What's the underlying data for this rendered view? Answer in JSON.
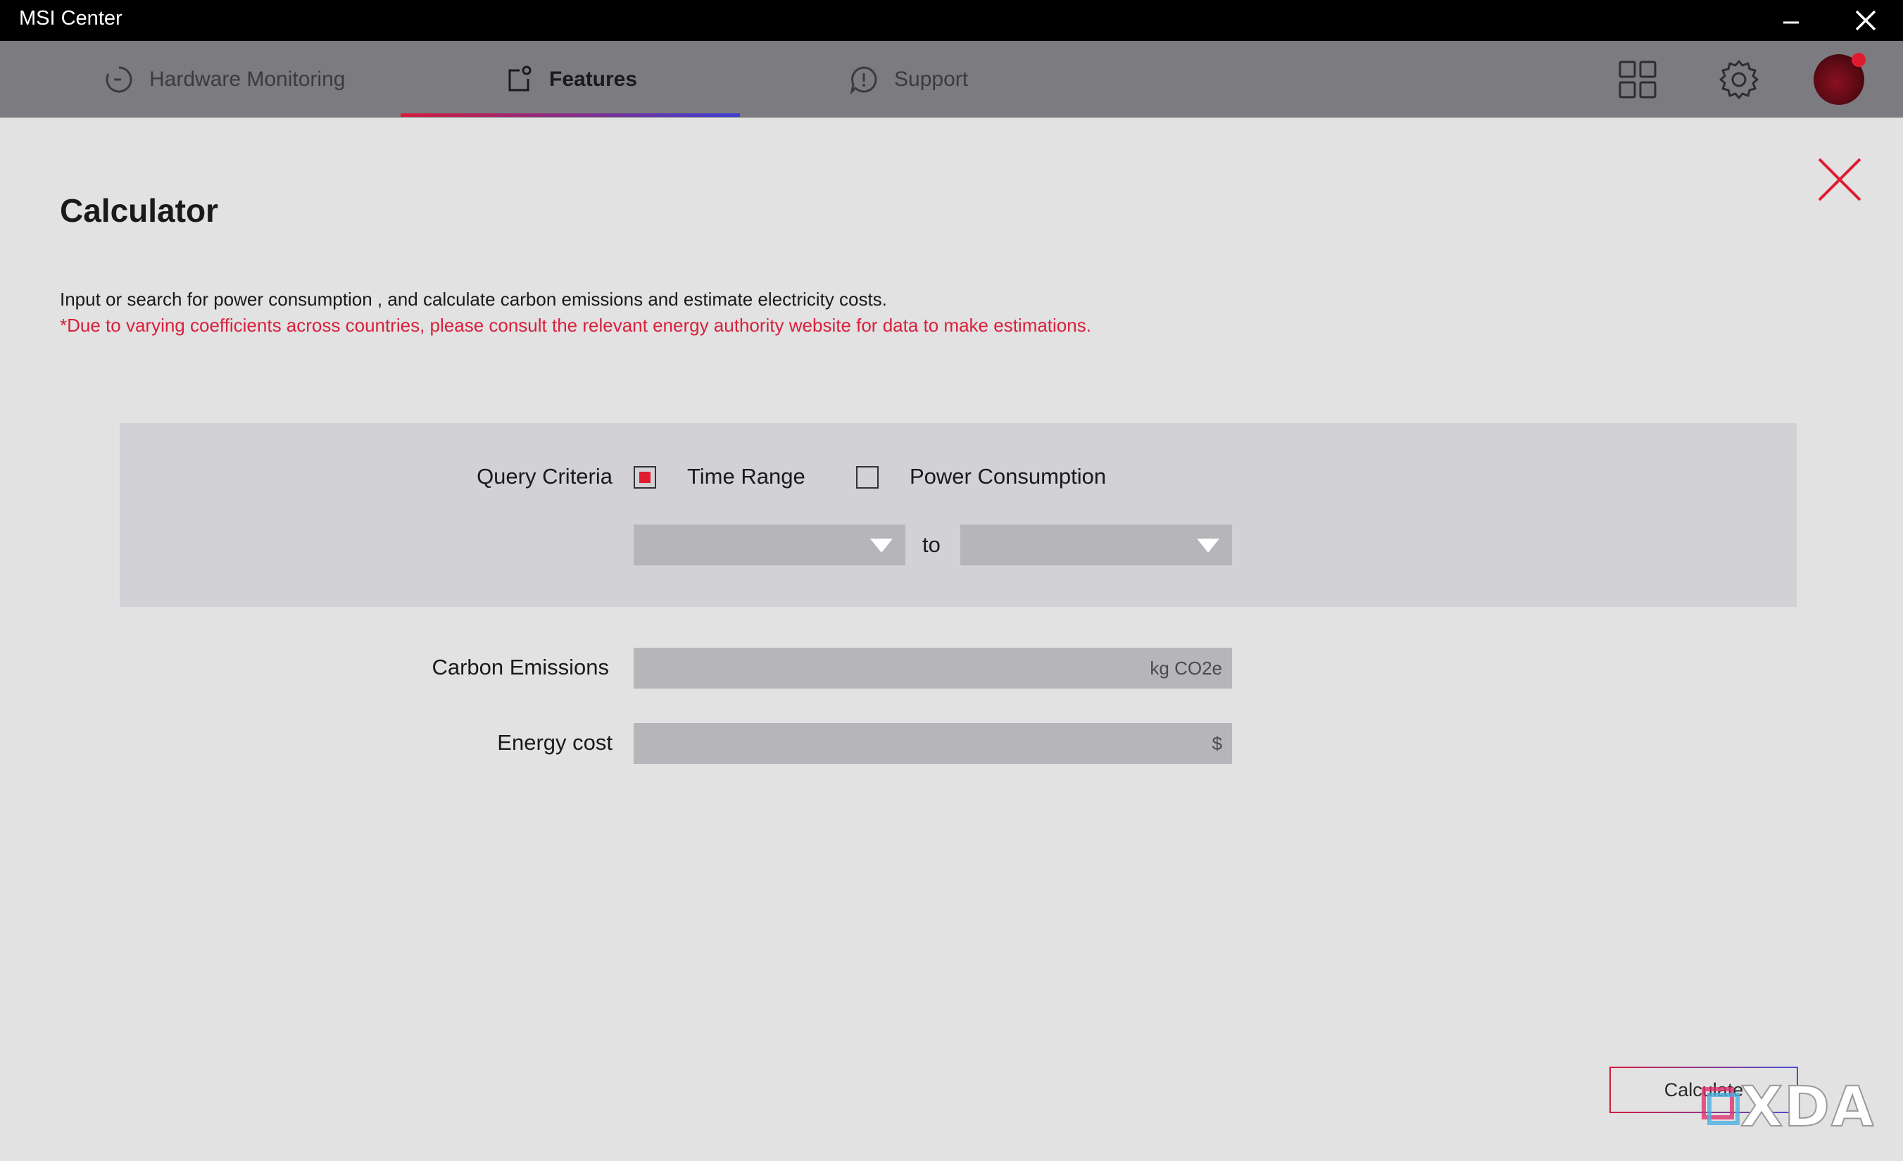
{
  "window": {
    "title": "MSI Center"
  },
  "nav": {
    "tabs": [
      {
        "label": "Hardware Monitoring",
        "icon": "gauge-icon",
        "active": false
      },
      {
        "label": "Features",
        "icon": "features-icon",
        "active": true
      },
      {
        "label": "Support",
        "icon": "support-icon",
        "active": false
      }
    ],
    "icons": [
      "grid-icon",
      "gear-icon",
      "avatar"
    ]
  },
  "calculator": {
    "title": "Calculator",
    "description": "Input or search for power consumption , and calculate carbon emissions and estimate electricity costs.",
    "warning": "*Due to varying coefficients across countries, please consult the relevant energy authority website for data to make estimations.",
    "query": {
      "label": "Query Criteria",
      "time_range": {
        "label": "Time Range",
        "checked": true
      },
      "power_consumption": {
        "label": "Power Consumption",
        "checked": false
      },
      "from_value": "",
      "to_label": "to",
      "to_value": ""
    },
    "carbon": {
      "label": "Carbon Emissions",
      "unit": "kg CO2e",
      "value": ""
    },
    "energy": {
      "label": "Energy cost",
      "unit": "$",
      "value": ""
    },
    "calculate_label": "Calculate"
  },
  "watermark": {
    "text": "XDA"
  },
  "colors": {
    "accent_red": "#e01b30",
    "accent_blue": "#3c3fd4",
    "titlebar": "#000000",
    "navbar": "#7c7c80",
    "panel_bg": "#e2e2e2"
  }
}
